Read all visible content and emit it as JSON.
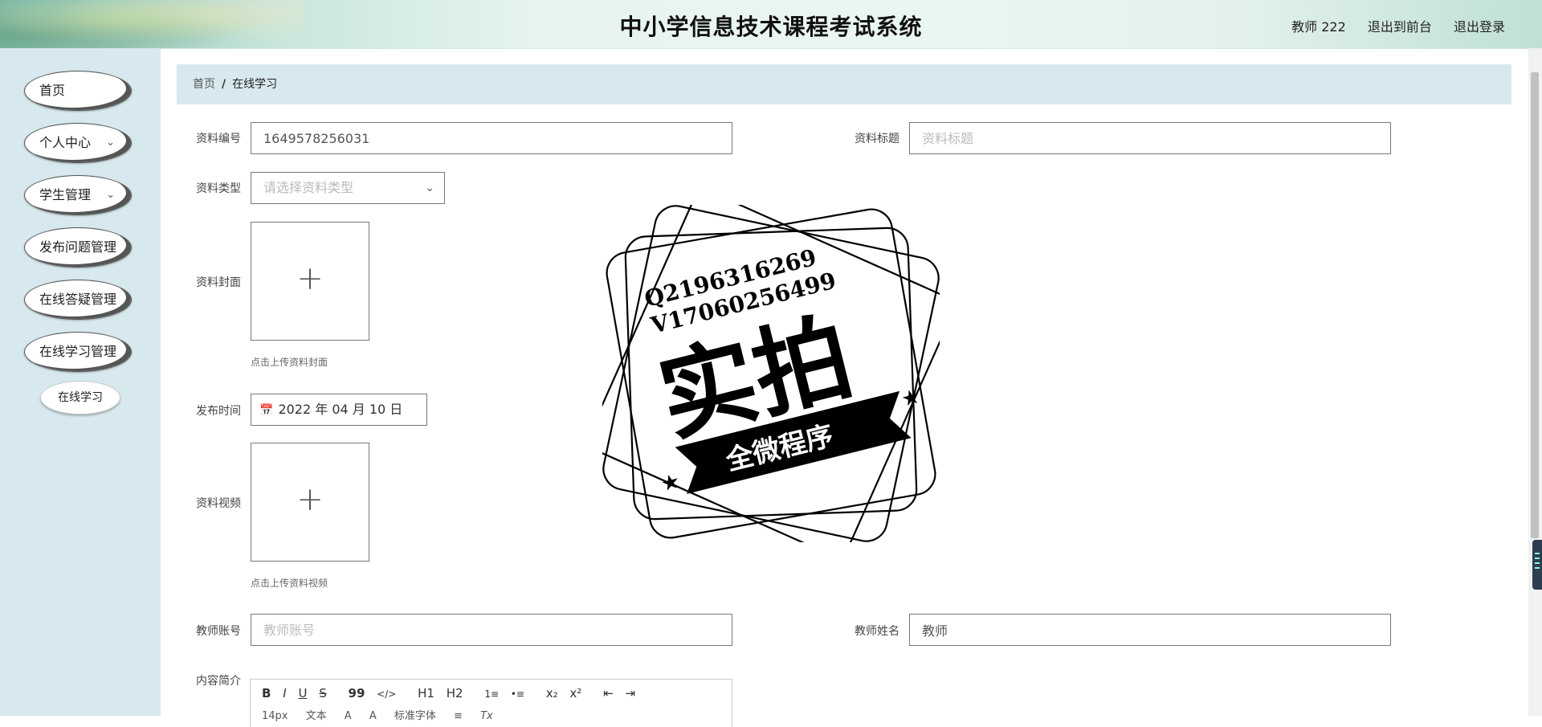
{
  "header": {
    "title": "中小学信息技术课程考试系统",
    "user_name": "教师 222",
    "back_to_front": "退出到前台",
    "logout": "退出登录"
  },
  "sidebar": {
    "items": [
      {
        "label": "首页",
        "has_submenu": false
      },
      {
        "label": "个人中心",
        "has_submenu": true
      },
      {
        "label": "学生管理",
        "has_submenu": true
      },
      {
        "label": "发布问题管理",
        "has_submenu": false
      },
      {
        "label": "在线答疑管理",
        "has_submenu": false
      },
      {
        "label": "在线学习管理",
        "has_submenu": false
      }
    ],
    "sub_item": "在线学习"
  },
  "breadcrumb": {
    "home": "首页",
    "separator": "/",
    "current": "在线学习"
  },
  "form": {
    "material_id": {
      "label": "资料编号",
      "value": "1649578256031"
    },
    "material_title": {
      "label": "资料标题",
      "placeholder": "资料标题"
    },
    "material_type": {
      "label": "资料类型",
      "placeholder": "请选择资料类型"
    },
    "cover": {
      "label": "资料封面",
      "hint": "点击上传资料封面"
    },
    "publish_time": {
      "label": "发布时间",
      "value": "2022 年 04 月 10 日"
    },
    "video": {
      "label": "资料视频",
      "hint": "点击上传资料视频"
    },
    "teacher_account": {
      "label": "教师账号",
      "placeholder": "教师账号"
    },
    "teacher_name": {
      "label": "教师姓名",
      "value": "教师"
    },
    "content_intro": {
      "label": "内容简介"
    }
  },
  "editor_toolbar": {
    "row1": [
      "B",
      "I",
      "U",
      "S",
      "99",
      "</>",
      "H1",
      "H2",
      "1≡",
      "•≡",
      "x₂",
      "x²",
      "⇤",
      "⇥"
    ],
    "row2": [
      "14px",
      "文本",
      "A",
      "A",
      "标准字体",
      "≡",
      "Tx"
    ]
  },
  "watermark": {
    "line1": "Q2196316269",
    "line2": "V17060256499",
    "main": "实拍",
    "ribbon": "全微程序"
  },
  "icons": {
    "chevron": "chevron-down-icon",
    "calendar": "calendar-icon",
    "plus": "plus-icon"
  }
}
